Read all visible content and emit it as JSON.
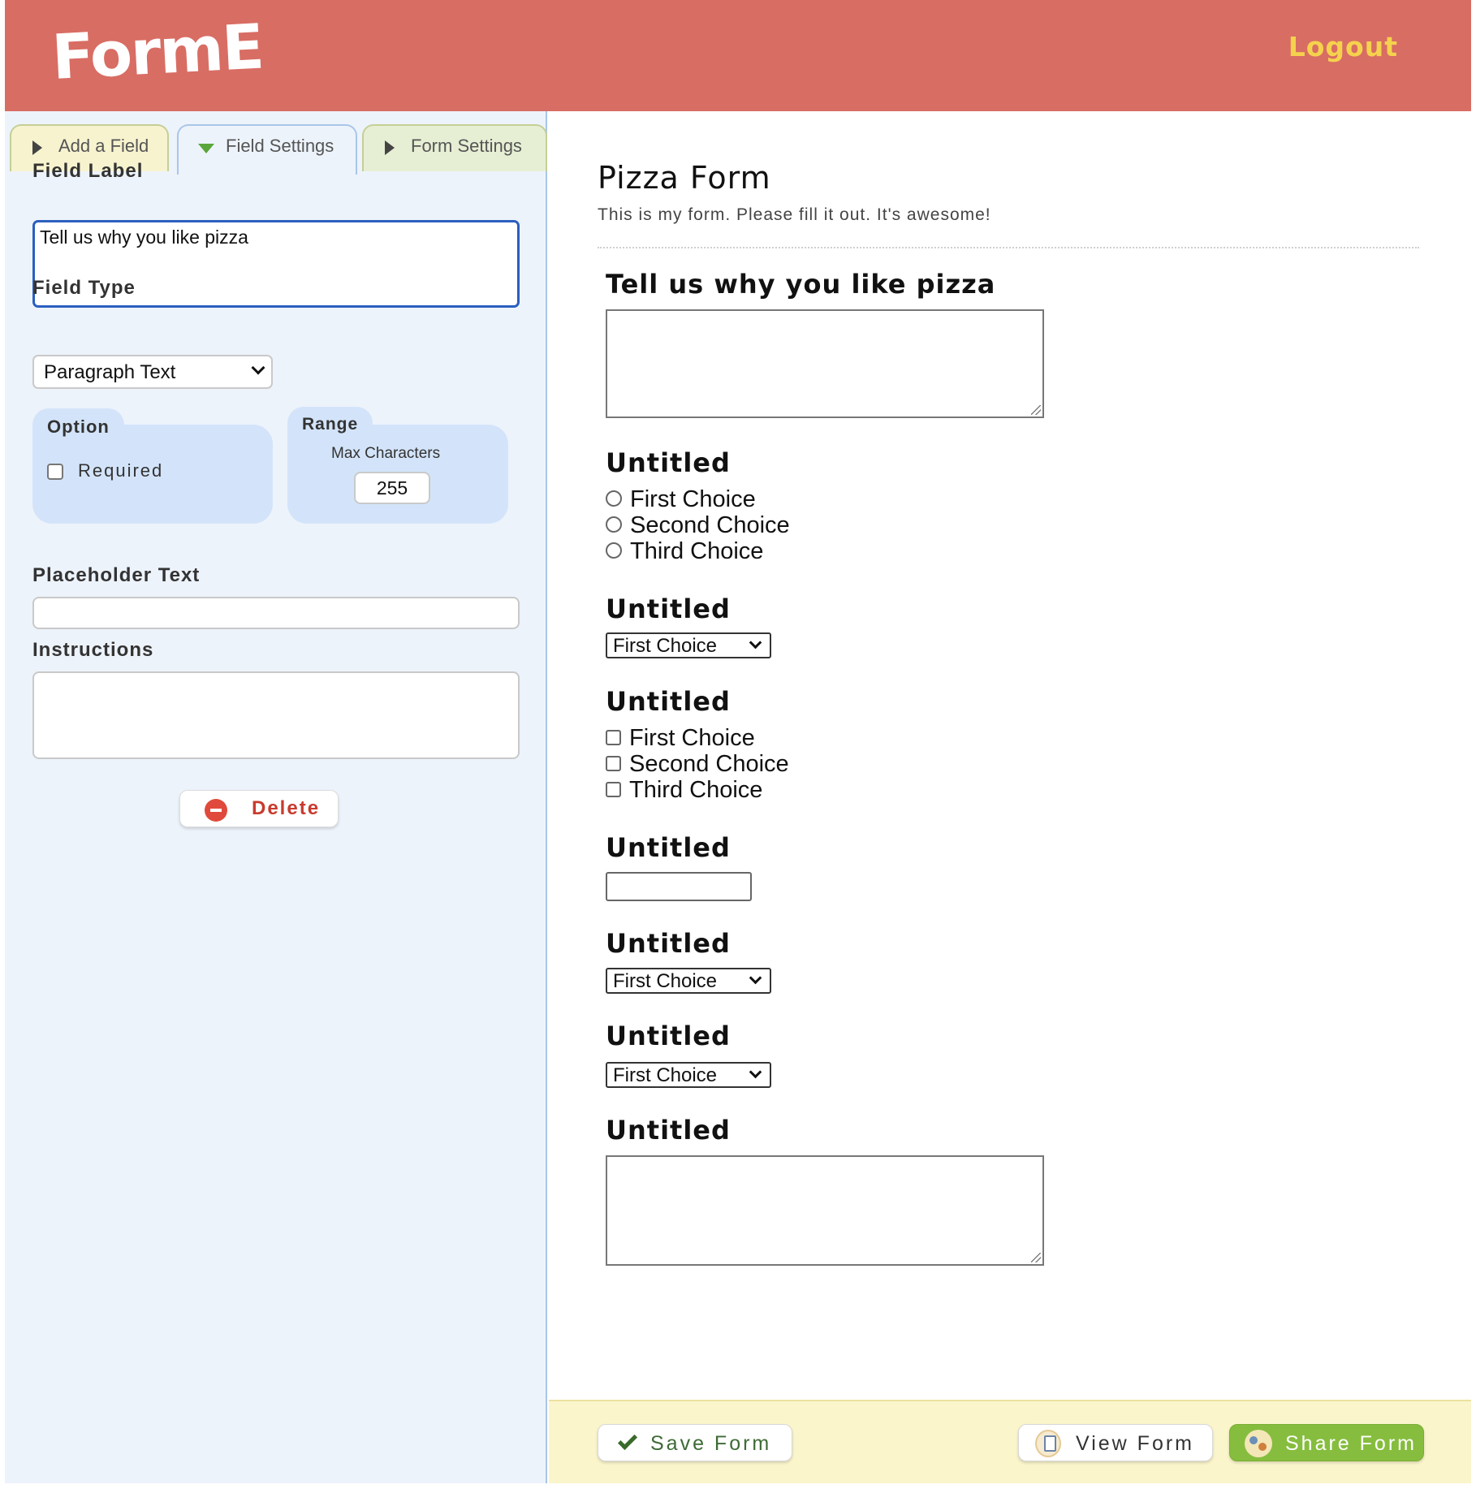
{
  "header": {
    "logo": "FormE",
    "logout_label": "Logout"
  },
  "sidebar": {
    "tabs": [
      {
        "label": "Add a Field",
        "state": "collapsed"
      },
      {
        "label": "Field Settings",
        "state": "expanded"
      },
      {
        "label": "Form Settings",
        "state": "collapsed"
      }
    ],
    "field_label": {
      "label": "Field Label",
      "value": "Tell us why you like pizza"
    },
    "field_type": {
      "label": "Field Type",
      "selected": "Paragraph Text"
    },
    "option": {
      "label": "Option",
      "required_label": "Required",
      "required_checked": false
    },
    "range": {
      "label": "Range",
      "max_label": "Max Characters",
      "max_value": "255"
    },
    "placeholder": {
      "label": "Placeholder Text",
      "value": ""
    },
    "instructions": {
      "label": "Instructions",
      "value": ""
    },
    "delete_label": "Delete"
  },
  "preview": {
    "title": "Pizza Form",
    "description": "This is my form. Please fill it out. It's awesome!",
    "fields": [
      {
        "label": "Tell us why you like pizza",
        "type": "textarea"
      },
      {
        "label": "Untitled",
        "type": "radio",
        "options": [
          "First Choice",
          "Second Choice",
          "Third Choice"
        ]
      },
      {
        "label": "Untitled",
        "type": "select",
        "selected": "First Choice"
      },
      {
        "label": "Untitled",
        "type": "checkbox",
        "options": [
          "First Choice",
          "Second Choice",
          "Third Choice"
        ]
      },
      {
        "label": "Untitled",
        "type": "text"
      },
      {
        "label": "Untitled",
        "type": "select",
        "selected": "First Choice"
      },
      {
        "label": "Untitled",
        "type": "select",
        "selected": "First Choice"
      },
      {
        "label": "Untitled",
        "type": "textarea"
      }
    ]
  },
  "footer": {
    "save_label": "Save Form",
    "view_label": "View Form",
    "share_label": "Share Form"
  },
  "colors": {
    "header_bg": "#d86d64",
    "logout": "#f5d24d",
    "sidebar_bg": "#edf3fb",
    "panel_bg": "#d3e4fa",
    "footer_bg": "#fbf5cc",
    "share_bg": "#86bd3e",
    "delete": "#c83b2e"
  }
}
